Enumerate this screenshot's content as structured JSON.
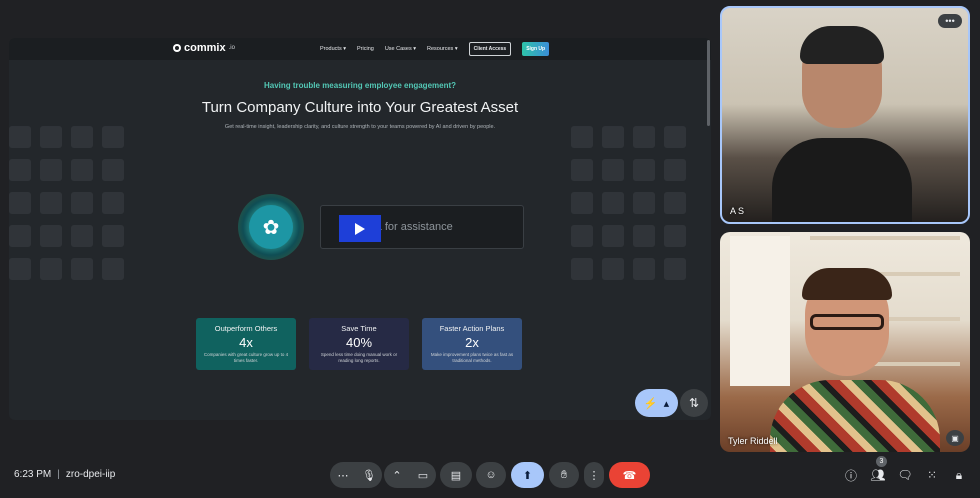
{
  "shared_screen": {
    "site": {
      "logo_text": "commix",
      "logo_suffix": ".io",
      "nav": [
        "Products ▾",
        "Pricing",
        "Use Cases ▾",
        "Resources ▾"
      ],
      "client_access": "Client Access",
      "sign_up": "Sign Up"
    },
    "hero": {
      "subtitle": "Having trouble measuring employee engagement?",
      "title": "Turn Company Culture into Your Greatest Asset",
      "description": "Get real-time insight, leadership clarity, and culture strength to your teams powered by AI and driven by people."
    },
    "assistant_placeholder": "Ask Mira for assistance",
    "cards": [
      {
        "title": "Outperform Others",
        "value": "4x",
        "desc": "Companies with great culture grow up to 4 times faster."
      },
      {
        "title": "Save Time",
        "value": "40%",
        "desc": "Spend less time doing manual work or reading long reports."
      },
      {
        "title": "Faster Action Plans",
        "value": "2x",
        "desc": "Make improvement plans twice as fast as traditional methods."
      }
    ]
  },
  "participants": [
    {
      "name": "A S"
    },
    {
      "name": "Tyler Riddell"
    }
  ],
  "meeting": {
    "time": "6:23 PM",
    "separator": "|",
    "code": "zro-dpei-iip",
    "people_count": "3"
  },
  "icons": {
    "more_options": "more-vert-icon",
    "mic": "mic-icon",
    "camera": "camera-icon",
    "captions": "captions-icon",
    "emoji": "emoji-icon",
    "present": "present-icon",
    "raise_hand": "hand-icon",
    "end_call": "end-call-icon"
  }
}
